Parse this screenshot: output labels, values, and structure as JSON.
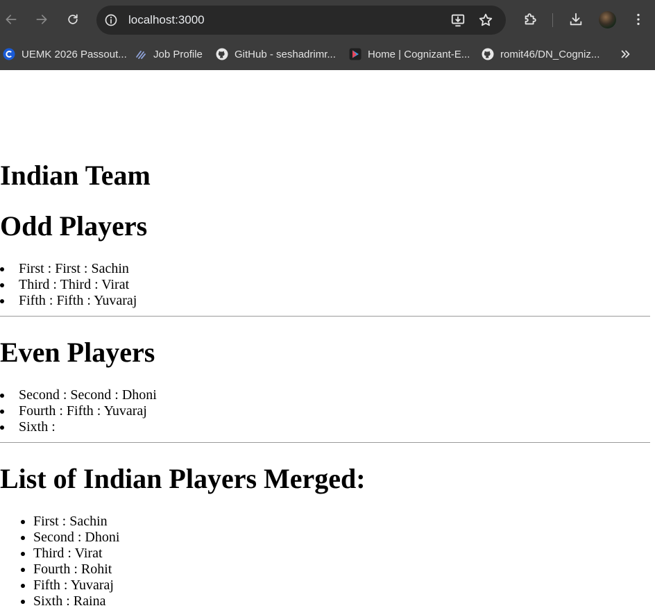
{
  "browser": {
    "url": "localhost:3000",
    "bookmarks": [
      {
        "label": "UEMK 2026 Passout...",
        "icon": "c-logo-icon"
      },
      {
        "label": "Job Profile",
        "icon": "job-profile-icon"
      },
      {
        "label": "GitHub - seshadrimr...",
        "icon": "github-icon"
      },
      {
        "label": "Home | Cognizant-E...",
        "icon": "play-logo-icon"
      },
      {
        "label": "romit46/DN_Cogniz...",
        "icon": "github-icon"
      }
    ]
  },
  "page": {
    "title": "Indian Team",
    "odd_heading": "Odd Players",
    "odd_players": [
      "First : First : Sachin",
      "Third : Third : Virat",
      "Fifth : Fifth : Yuvaraj"
    ],
    "even_heading": "Even Players",
    "even_players": [
      "Second : Second : Dhoni",
      "Fourth : Fifth : Yuvaraj",
      "Sixth :"
    ],
    "merged_heading": "List of Indian Players Merged:",
    "merged_players": [
      "First : Sachin",
      "Second : Dhoni",
      "Third : Virat",
      "Fourth : Rohit",
      "Fifth : Yuvaraj",
      "Sixth : Raina"
    ]
  }
}
